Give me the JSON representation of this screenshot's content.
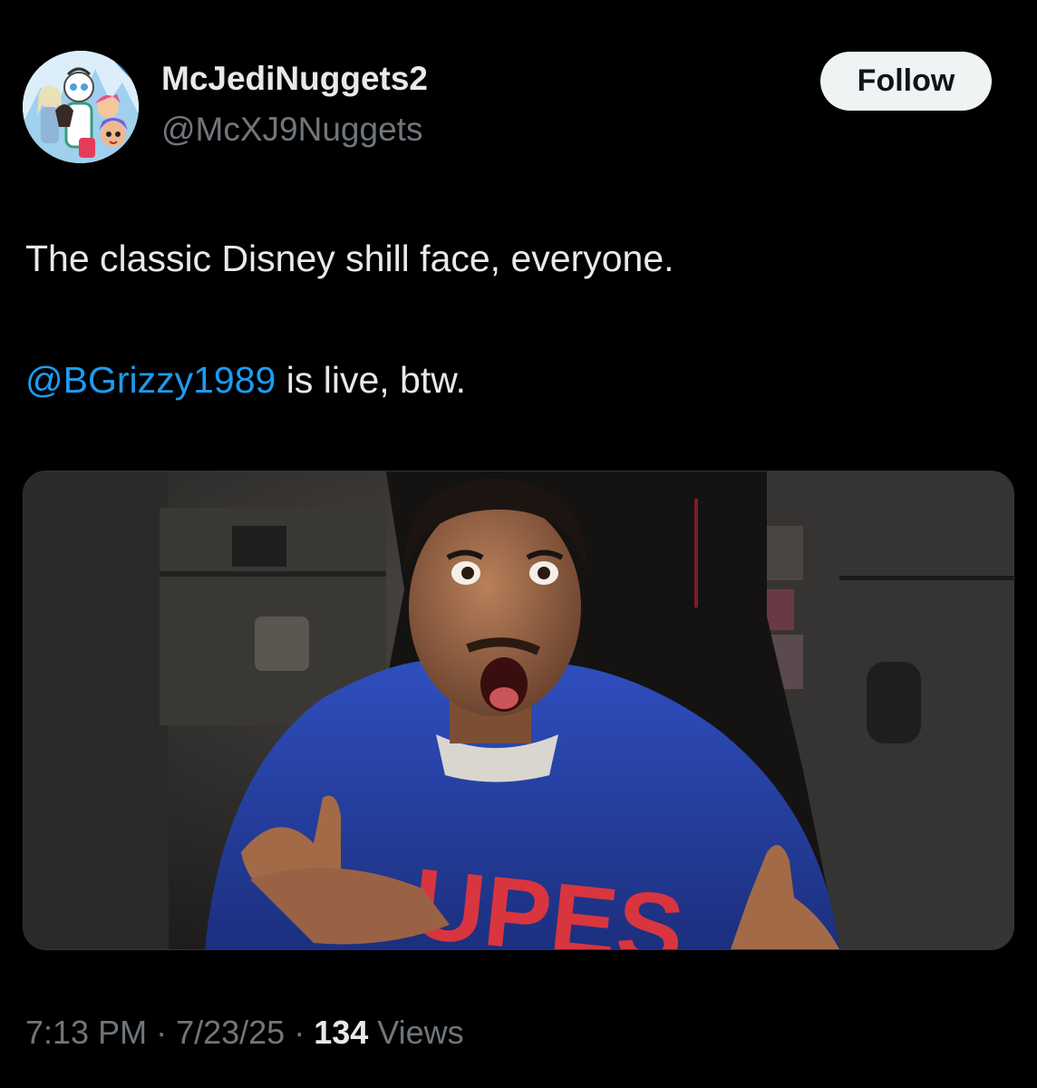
{
  "colors": {
    "background": "#000000",
    "text_primary": "#e7e9ea",
    "text_secondary": "#71767b",
    "mention": "#1d9bf0",
    "follow_bg": "#eff3f4"
  },
  "author": {
    "display_name": "McJediNuggets2",
    "handle": "@McXJ9Nuggets",
    "avatar_icon": "cartoon-characters-avatar-icon"
  },
  "follow_label": "Follow",
  "tweet": {
    "text_line1": "The classic Disney shill face, everyone.",
    "mention": "@BGrizzy1989",
    "text_line2_rest": " is live, btw."
  },
  "media": {
    "icon": "video-frame-image",
    "jersey_text": "UPES"
  },
  "meta": {
    "time": "7:13 PM",
    "sep1": " · ",
    "date": "7/23/25",
    "sep2": " · ",
    "views_count": "134",
    "views_label": " Views"
  }
}
